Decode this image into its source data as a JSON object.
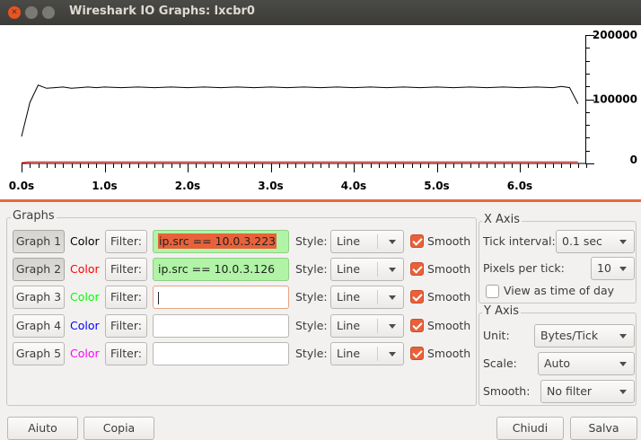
{
  "window": {
    "title": "Wireshark IO Graphs: lxcbr0"
  },
  "chart_data": {
    "type": "line",
    "x_ticks": [
      "0.0s",
      "1.0s",
      "2.0s",
      "3.0s",
      "4.0s",
      "5.0s",
      "6.0s"
    ],
    "y_ticks": [
      "0",
      "100000",
      "200000"
    ],
    "ylim": [
      0,
      200000
    ],
    "xlim": [
      0,
      6.8
    ],
    "series": [
      {
        "color": "#000000",
        "x": [
          0.0,
          0.1,
          0.2,
          0.3,
          0.4,
          0.5,
          0.6,
          0.7,
          0.8,
          0.9,
          1.0,
          1.2,
          1.4,
          1.6,
          1.8,
          2.0,
          2.2,
          2.4,
          2.6,
          2.8,
          3.0,
          3.2,
          3.4,
          3.6,
          3.8,
          4.0,
          4.2,
          4.4,
          4.6,
          4.8,
          5.0,
          5.2,
          5.4,
          5.6,
          5.8,
          6.0,
          6.2,
          6.4,
          6.5,
          6.6,
          6.7
        ],
        "values": [
          42000,
          95000,
          122000,
          117000,
          118000,
          119000,
          117000,
          118000,
          119000,
          118000,
          119000,
          118000,
          119000,
          118000,
          119000,
          118000,
          119000,
          118000,
          119000,
          118000,
          119000,
          118000,
          119000,
          118000,
          119000,
          118000,
          119000,
          118000,
          119000,
          118000,
          119000,
          118000,
          119000,
          118000,
          119000,
          118000,
          119000,
          118000,
          120000,
          118000,
          93000
        ]
      },
      {
        "color": "#ff0000",
        "x": [
          0.0,
          0.1,
          0.2,
          6.7
        ],
        "values": [
          1000,
          2500,
          2500,
          2500
        ]
      }
    ]
  },
  "graphs_panel": {
    "title": "Graphs",
    "filter_label": "Filter:",
    "style_label": "Style:",
    "smooth_label": "Smooth",
    "rows": [
      {
        "button": "Graph 1",
        "color_label": "Color",
        "color": "#000000",
        "filter": "ip.src == 10.0.3.223",
        "style": "Line",
        "smooth": true
      },
      {
        "button": "Graph 2",
        "color_label": "Color",
        "color": "#ff0000",
        "filter": "ip.src == 10.0.3.126",
        "style": "Line",
        "smooth": true
      },
      {
        "button": "Graph 3",
        "color_label": "Color",
        "color": "#00ff00",
        "filter": "",
        "style": "Line",
        "smooth": true
      },
      {
        "button": "Graph 4",
        "color_label": "Color",
        "color": "#0000ff",
        "filter": "",
        "style": "Line",
        "smooth": true
      },
      {
        "button": "Graph 5",
        "color_label": "Color",
        "color": "#ff00ff",
        "filter": "",
        "style": "Line",
        "smooth": true
      }
    ]
  },
  "x_axis": {
    "title": "X Axis",
    "tick_interval_label": "Tick interval:",
    "tick_interval_value": "0.1 sec",
    "pixels_per_tick_label": "Pixels per tick:",
    "pixels_per_tick_value": "10",
    "view_as_time_of_day_label": "View as time of day"
  },
  "y_axis": {
    "title": "Y Axis",
    "unit_label": "Unit:",
    "unit_value": "Bytes/Tick",
    "scale_label": "Scale:",
    "scale_value": "Auto",
    "smooth_label": "Smooth:",
    "smooth_value": "No filter"
  },
  "footer": {
    "help": "Aiuto",
    "copy": "Copia",
    "close": "Chiudi",
    "save": "Salva"
  }
}
